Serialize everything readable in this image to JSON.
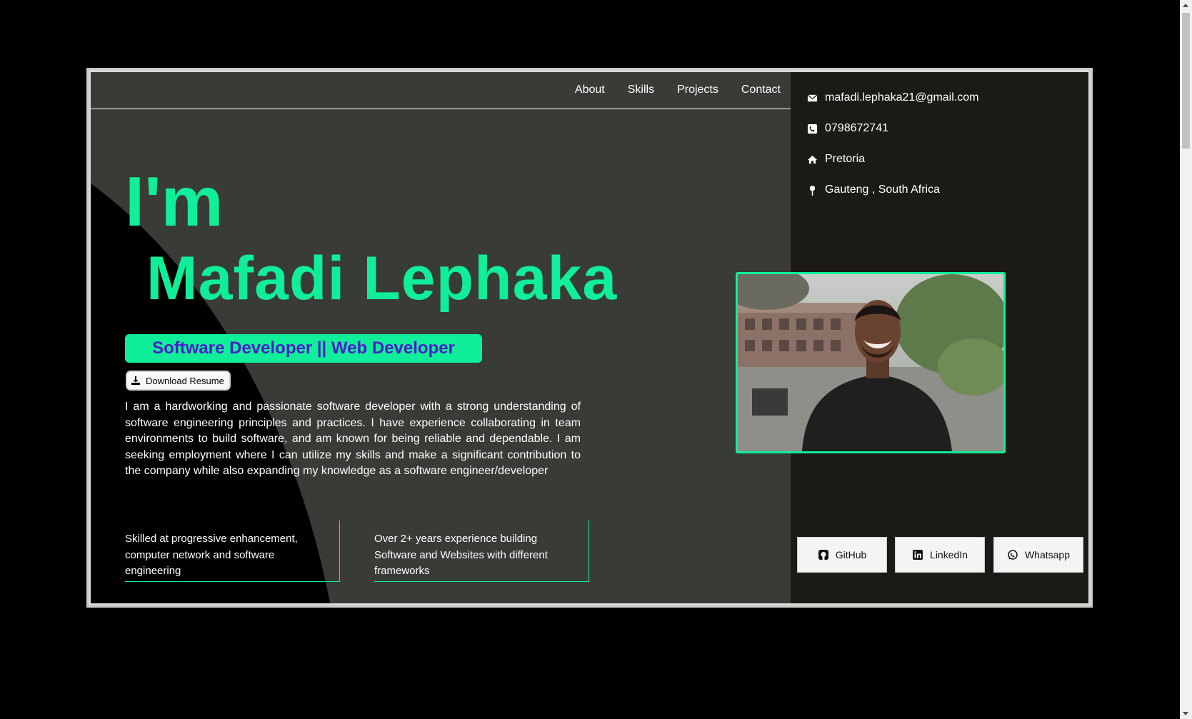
{
  "nav": {
    "items": [
      {
        "label": "About"
      },
      {
        "label": "Skills"
      },
      {
        "label": "Projects"
      },
      {
        "label": "Contact"
      }
    ]
  },
  "hero": {
    "greeting": "I'm",
    "name": "Mafadi Lephaka",
    "role": "Software Developer || Web Developer",
    "download_label": "Download Resume",
    "bio": "I am a hardworking and passionate software developer with a strong understanding of software engineering principles and practices. I have experience collaborating in team environments to build software, and am known for being reliable and dependable. I am seeking employment where I can utilize my skills and make a significant contribution to the company while also expanding my knowledge as a software engineer/developer"
  },
  "cards": [
    {
      "text": "Skilled at progressive enhancement, computer network and software engineering"
    },
    {
      "text": "Over 2+ years experience building Software and Websites with different frameworks"
    }
  ],
  "contact": {
    "email": "mafadi.lephaka21@gmail.com",
    "phone": "0798672741",
    "city": "Pretoria",
    "region": "Gauteng , South Africa"
  },
  "social": {
    "github": "GitHub",
    "linkedin": "LinkedIn",
    "whatsapp": "Whatsapp"
  },
  "colors": {
    "accent": "#10ee99",
    "role_text": "#4a1ec9",
    "panel": "#393b37",
    "side_panel": "#1c1a14"
  },
  "icons": {
    "email": "envelope-icon",
    "phone": "phone-square-icon",
    "city": "home-icon",
    "region": "map-pin-icon",
    "github": "github-icon",
    "linkedin": "linkedin-icon",
    "whatsapp": "whatsapp-icon",
    "download": "download-icon"
  }
}
